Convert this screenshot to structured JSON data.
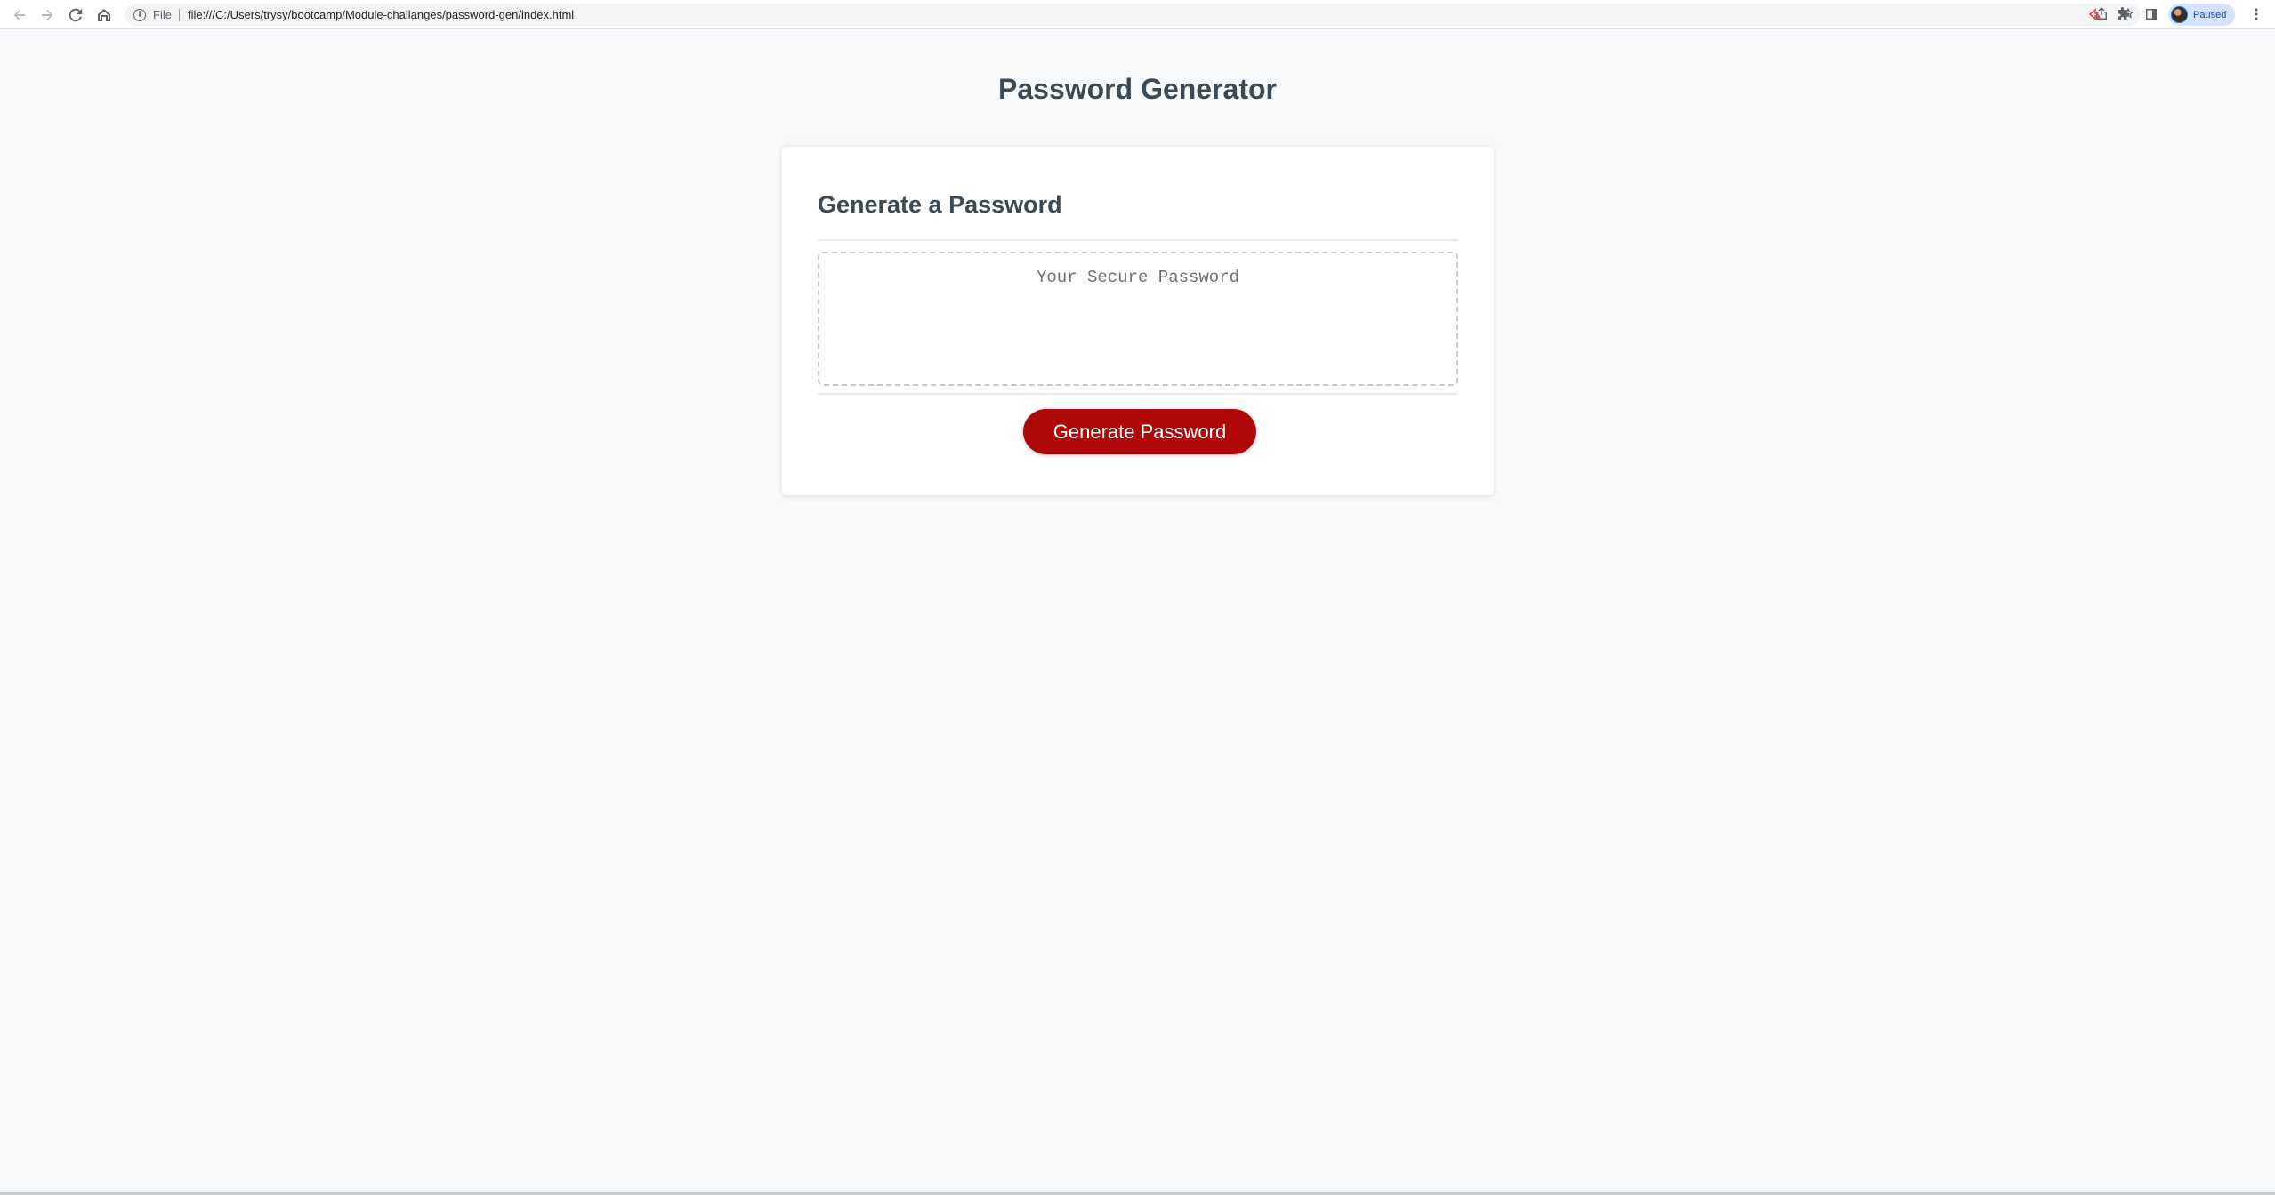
{
  "browser": {
    "scheme_label": "File",
    "url": "file:///C:/Users/trysy/bootcamp/Module-challanges/password-gen/index.html",
    "profile_status": "Paused",
    "icons": {
      "back": "arrow-left-icon",
      "forward": "arrow-right-icon",
      "reload": "reload-icon",
      "home": "home-icon",
      "info": "info-icon",
      "share": "share-icon",
      "bookmark": "star-icon",
      "extension": "extension-icon",
      "extensions_menu": "puzzle-icon",
      "side_panel": "side-panel-icon",
      "menu": "more-vert-icon"
    }
  },
  "page": {
    "title": "Password Generator",
    "card": {
      "heading": "Generate a Password",
      "password_placeholder": "Your Secure Password",
      "password_value": "",
      "generate_button_label": "Generate Password"
    }
  },
  "colors": {
    "background": "#f8f9fb",
    "text": "#3b4a57",
    "button": "#b00a0a",
    "card": "#ffffff"
  }
}
